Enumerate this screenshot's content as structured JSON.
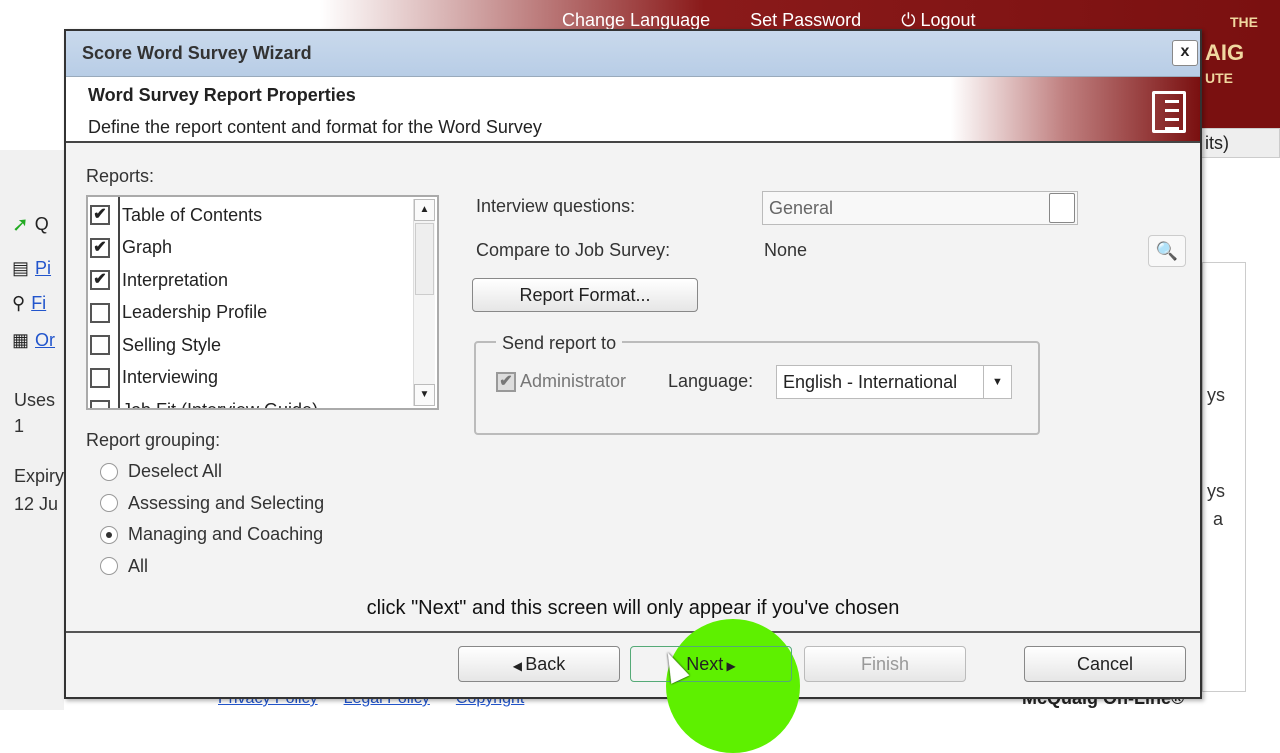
{
  "topnav": {
    "links": [
      "Change Language",
      "Set Password",
      "Logout"
    ],
    "logo_top": "THE",
    "logo_mid": "AIG",
    "logo_bot": "UTE"
  },
  "background": {
    "tab_partial": "its)",
    "side_links": [
      "Pi",
      "Fi",
      "Or"
    ],
    "uses_label": "Uses",
    "uses_value": "1",
    "expiry_label": "Expiry",
    "expiry_value": "12 Ju",
    "q_label": "Q",
    "right_text": [
      "ys",
      "ys",
      "a"
    ],
    "footer_links": [
      "Privacy Policy",
      "Legal Policy",
      "Copyright"
    ],
    "brand": "McQuaig On-Line®"
  },
  "dialog": {
    "title": "Score Word Survey Wizard",
    "close_label": "x",
    "header_title": "Word Survey Report Properties",
    "header_subtitle": "Define the report content and format for the Word Survey",
    "reports_label": "Reports:",
    "reports": [
      {
        "label": "Table of Contents",
        "checked": true
      },
      {
        "label": "Graph",
        "checked": true
      },
      {
        "label": "Interpretation",
        "checked": true
      },
      {
        "label": "Leadership Profile",
        "checked": false
      },
      {
        "label": "Selling Style",
        "checked": false
      },
      {
        "label": "Interviewing",
        "checked": false
      },
      {
        "label": "Job Fit (Interview Guide)",
        "checked": false
      }
    ],
    "grouping_label": "Report grouping:",
    "grouping": [
      {
        "label": "Deselect All",
        "selected": false
      },
      {
        "label": "Assessing and Selecting",
        "selected": false
      },
      {
        "label": "Managing and Coaching",
        "selected": true
      },
      {
        "label": "All",
        "selected": false
      }
    ],
    "interview_label": "Interview questions:",
    "interview_value": "General",
    "compare_label": "Compare to Job Survey:",
    "compare_value": "None",
    "report_format_button": "Report Format...",
    "send_to_legend": "Send report to",
    "administrator_label": "Administrator",
    "administrator_checked": true,
    "language_label": "Language:",
    "language_value": "English - International",
    "caption": "click \"Next\" and this screen will only appear if you've chosen",
    "buttons": {
      "back": "Back",
      "next": "Next",
      "finish": "Finish",
      "cancel": "Cancel"
    },
    "highlight_color": "#5ef000"
  }
}
